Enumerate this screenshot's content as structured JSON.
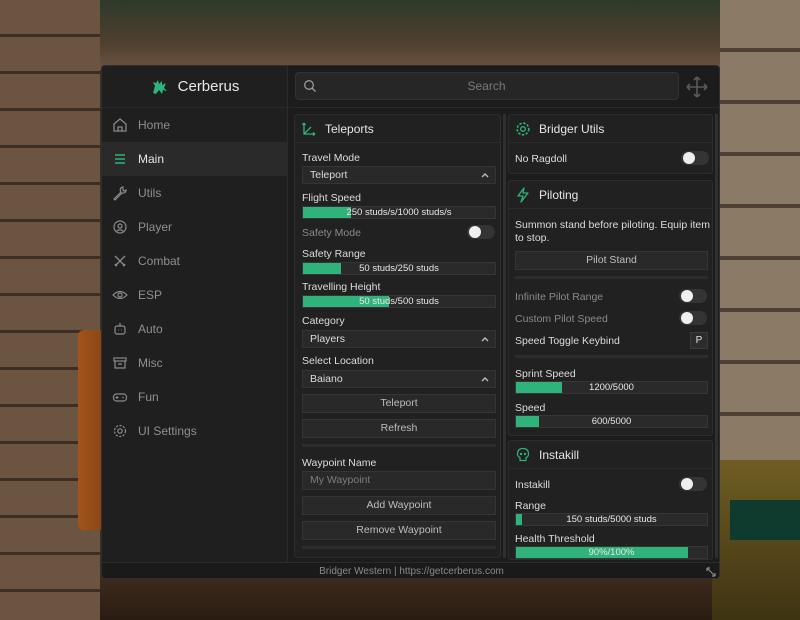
{
  "colors": {
    "accent": "#2fb37a",
    "panel": "#212121",
    "window": "#1c1c1c"
  },
  "brand": {
    "name": "Cerberus",
    "logo": "cerberus-logo-icon"
  },
  "search": {
    "placeholder": "Search"
  },
  "nav": [
    {
      "label": "Home",
      "icon": "home-icon"
    },
    {
      "label": "Main",
      "icon": "menu-icon",
      "active": true
    },
    {
      "label": "Utils",
      "icon": "wrench-icon"
    },
    {
      "label": "Player",
      "icon": "user-circle-icon"
    },
    {
      "label": "Combat",
      "icon": "swords-icon"
    },
    {
      "label": "ESP",
      "icon": "eye-icon"
    },
    {
      "label": "Auto",
      "icon": "bot-icon"
    },
    {
      "label": "Misc",
      "icon": "archive-icon"
    },
    {
      "label": "Fun",
      "icon": "gamepad-icon"
    },
    {
      "label": "UI Settings",
      "icon": "gear-icon"
    }
  ],
  "teleports": {
    "title": "Teleports",
    "travel_mode": {
      "label": "Travel Mode",
      "value": "Teleport"
    },
    "flight_speed": {
      "label": "Flight Speed",
      "text": "250 studs/s/1000 studs/s",
      "fraction": 0.25
    },
    "safety_mode": {
      "label": "Safety Mode",
      "on": false
    },
    "safety_range": {
      "label": "Safety Range",
      "text": "50 studs/250 studs",
      "fraction": 0.2
    },
    "travelling_height": {
      "label": "Travelling Height",
      "text": "50 studs/500 studs",
      "fraction": 0.45
    },
    "category": {
      "label": "Category",
      "value": "Players"
    },
    "select_location": {
      "label": "Select Location",
      "value": "Baiano"
    },
    "teleport_button": "Teleport",
    "refresh_button": "Refresh",
    "waypoint_name": {
      "label": "Waypoint Name",
      "placeholder": "My Waypoint"
    },
    "add_waypoint_button": "Add Waypoint",
    "remove_waypoint_button": "Remove Waypoint"
  },
  "bridger_utils": {
    "title": "Bridger Utils",
    "no_ragdoll": {
      "label": "No Ragdoll",
      "on": false
    }
  },
  "piloting": {
    "title": "Piloting",
    "description": "Summon stand before piloting. Equip item to stop.",
    "pilot_stand_button": "Pilot Stand",
    "infinite_pilot_range": {
      "label": "Infinite Pilot Range",
      "on": false
    },
    "custom_pilot_speed": {
      "label": "Custom Pilot Speed",
      "on": false
    },
    "speed_toggle_keybind": {
      "label": "Speed Toggle Keybind",
      "key": "P"
    },
    "sprint_speed": {
      "label": "Sprint Speed",
      "text": "1200/5000",
      "fraction": 0.24
    },
    "speed": {
      "label": "Speed",
      "text": "600/5000",
      "fraction": 0.12
    }
  },
  "instakill": {
    "title": "Instakill",
    "instakill_toggle": {
      "label": "Instakill",
      "on": false
    },
    "range": {
      "label": "Range",
      "text": "150 studs/5000 studs",
      "fraction": 0.03
    },
    "health_threshold": {
      "label": "Health Threshold",
      "text": "90%/100%",
      "fraction": 0.9
    }
  },
  "footer": {
    "text": "Bridger Western | https://getcerberus.com"
  }
}
